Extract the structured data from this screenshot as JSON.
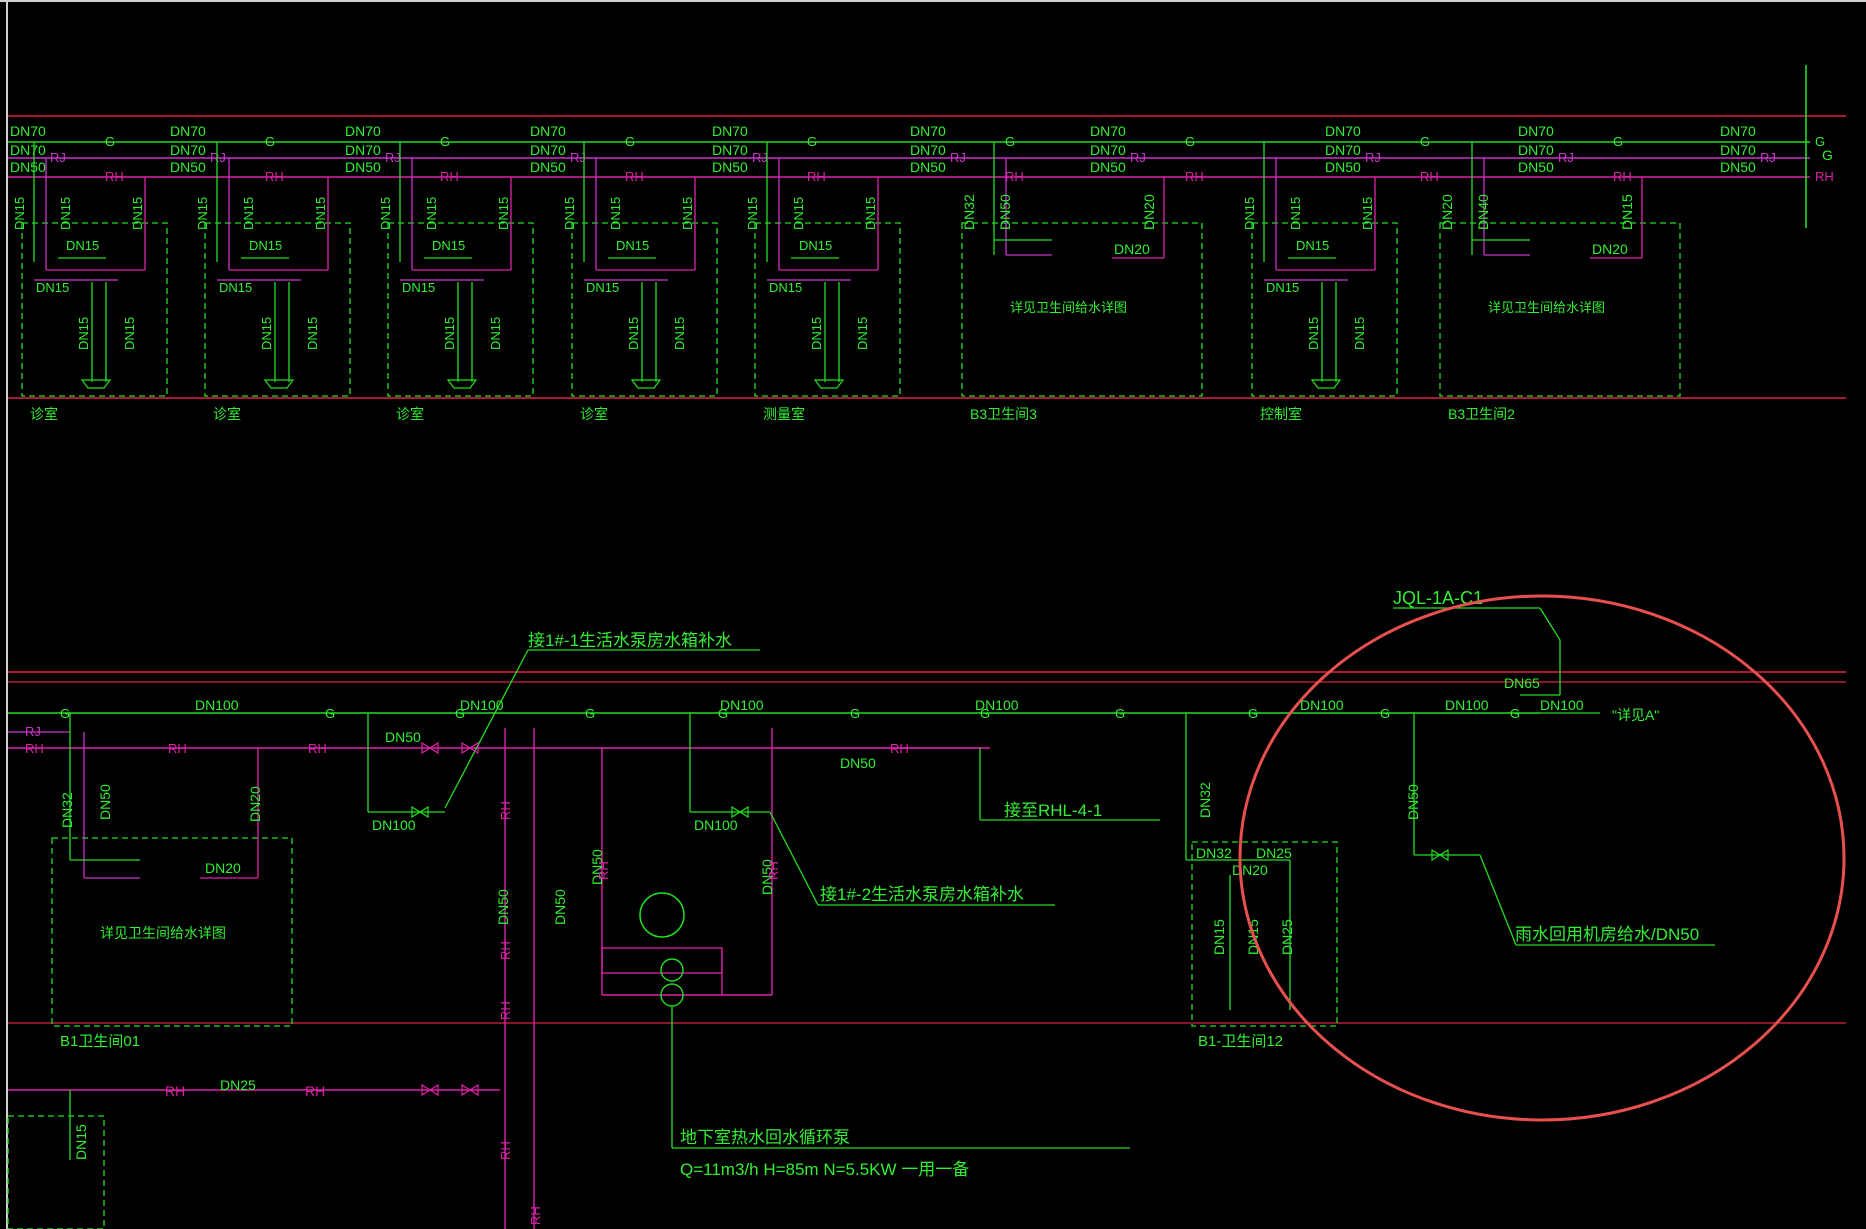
{
  "colors": {
    "background": "#000000",
    "supply_g": "#22dd22",
    "hot_rh": "#dd22aa",
    "rj": "#cc33cc",
    "text": "#33ee33",
    "highlight": "#e85050",
    "border": "#d0d0d0"
  },
  "upper": {
    "pipe_tags": {
      "g": "G",
      "rj": "RJ",
      "rh": "RH"
    },
    "main_sizes": [
      "DN70",
      "DN70",
      "DN50"
    ],
    "fixture_sizes": {
      "riser": "DN15",
      "branch": "DN15",
      "drop": "DN15",
      "large_a": "DN32",
      "large_b": "DN50",
      "large_c": "DN20",
      "large_d": "DN40"
    },
    "rooms": [
      {
        "label": "诊室"
      },
      {
        "label": "诊室"
      },
      {
        "label": "诊室"
      },
      {
        "label": "诊室"
      },
      {
        "label": "测量室"
      },
      {
        "label": "B3卫生间3",
        "note": "详见卫生间给水详图"
      },
      {
        "label": "控制室"
      },
      {
        "label": "B3卫生间2",
        "note": "详见卫生间给水详图"
      }
    ]
  },
  "lower": {
    "main_size": "DN100",
    "labels": {
      "dn50_a": "DN50",
      "dn100_a": "DN100",
      "dn50_b": "DN50",
      "dn100_b": "DN100",
      "dn32": "DN32",
      "dn50_c": "DN50",
      "dn20": "DN20",
      "dn25": "DN25",
      "dn65": "DN65",
      "dn15": "DN15",
      "dn32_b": "DN32",
      "dn25_b": "DN25",
      "dn20_b": "DN20",
      "dn50_v1": "DN50",
      "dn50_v2": "DN50",
      "dn50_v3": "DN50",
      "dn50_v4": "DN50"
    },
    "callouts": {
      "tank1": "接1#-1生活水泵房水箱补水",
      "tank2": "接1#-2生活水泵房水箱补水",
      "rhl": "接至RHL-4-1",
      "pump_title": "地下室热水回水循环泵",
      "pump_spec": "Q=11m3/h  H=85m  N=5.5KW  一用一备",
      "rain": "雨水回用机房给水/DN50",
      "joint": "JQL-1A-C1",
      "ref": "\"详见A\""
    },
    "room_b1_01": {
      "label": "B1卫生间01",
      "note": "详见卫生间给水详图"
    },
    "room_b1_12": {
      "label": "B1-卫生间12"
    }
  }
}
